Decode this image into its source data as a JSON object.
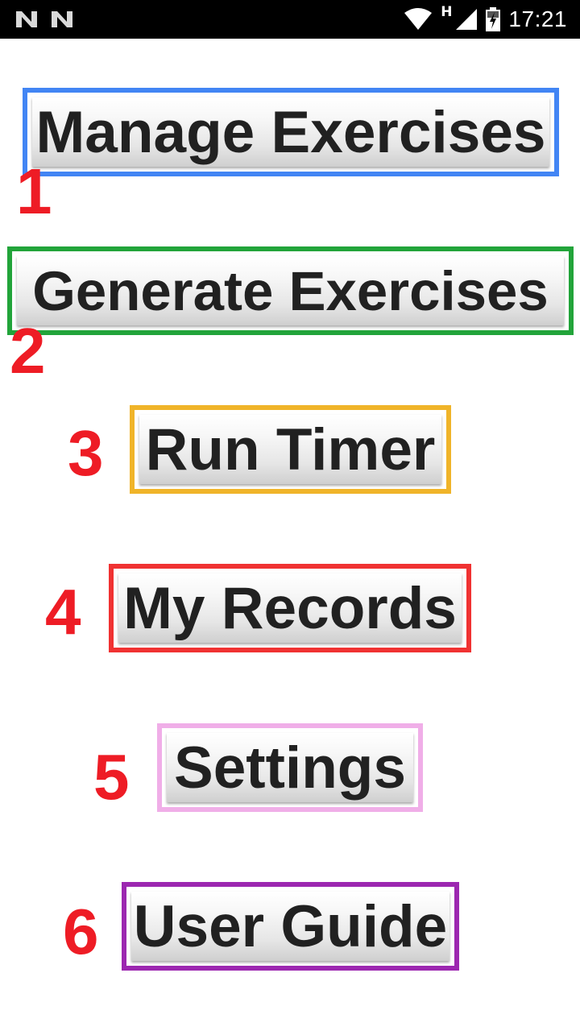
{
  "status_bar": {
    "notification_icons": [
      "n-notification-icon",
      "n-notification-icon"
    ],
    "network_type": "H",
    "time": "17:21",
    "icons": [
      "wifi-icon",
      "cell-signal-icon",
      "battery-charging-icon"
    ]
  },
  "menu": {
    "items": [
      {
        "number": "1",
        "label": "Manage Exercises",
        "border_color": "#4285f4"
      },
      {
        "number": "2",
        "label": "Generate Exercises",
        "border_color": "#22a43a"
      },
      {
        "number": "3",
        "label": "Run Timer",
        "border_color": "#f0b429"
      },
      {
        "number": "4",
        "label": "My Records",
        "border_color": "#f03232"
      },
      {
        "number": "5",
        "label": "Settings",
        "border_color": "#f0aee8"
      },
      {
        "number": "6",
        "label": "User Guide",
        "border_color": "#9c27b0"
      }
    ]
  },
  "colors": {
    "number_annotation": "#ee1c25",
    "button_text": "#212121",
    "status_bar_bg": "#000000"
  }
}
